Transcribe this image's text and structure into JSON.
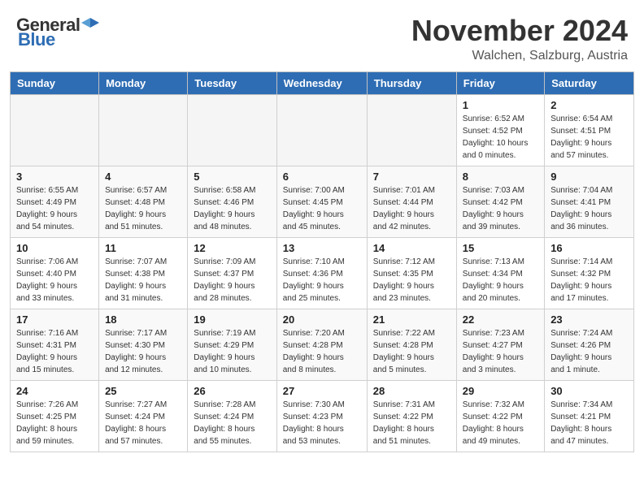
{
  "header": {
    "logo_general": "General",
    "logo_blue": "Blue",
    "month": "November 2024",
    "location": "Walchen, Salzburg, Austria"
  },
  "weekdays": [
    "Sunday",
    "Monday",
    "Tuesday",
    "Wednesday",
    "Thursday",
    "Friday",
    "Saturday"
  ],
  "weeks": [
    [
      {
        "day": "",
        "info": ""
      },
      {
        "day": "",
        "info": ""
      },
      {
        "day": "",
        "info": ""
      },
      {
        "day": "",
        "info": ""
      },
      {
        "day": "",
        "info": ""
      },
      {
        "day": "1",
        "info": "Sunrise: 6:52 AM\nSunset: 4:52 PM\nDaylight: 10 hours\nand 0 minutes."
      },
      {
        "day": "2",
        "info": "Sunrise: 6:54 AM\nSunset: 4:51 PM\nDaylight: 9 hours\nand 57 minutes."
      }
    ],
    [
      {
        "day": "3",
        "info": "Sunrise: 6:55 AM\nSunset: 4:49 PM\nDaylight: 9 hours\nand 54 minutes."
      },
      {
        "day": "4",
        "info": "Sunrise: 6:57 AM\nSunset: 4:48 PM\nDaylight: 9 hours\nand 51 minutes."
      },
      {
        "day": "5",
        "info": "Sunrise: 6:58 AM\nSunset: 4:46 PM\nDaylight: 9 hours\nand 48 minutes."
      },
      {
        "day": "6",
        "info": "Sunrise: 7:00 AM\nSunset: 4:45 PM\nDaylight: 9 hours\nand 45 minutes."
      },
      {
        "day": "7",
        "info": "Sunrise: 7:01 AM\nSunset: 4:44 PM\nDaylight: 9 hours\nand 42 minutes."
      },
      {
        "day": "8",
        "info": "Sunrise: 7:03 AM\nSunset: 4:42 PM\nDaylight: 9 hours\nand 39 minutes."
      },
      {
        "day": "9",
        "info": "Sunrise: 7:04 AM\nSunset: 4:41 PM\nDaylight: 9 hours\nand 36 minutes."
      }
    ],
    [
      {
        "day": "10",
        "info": "Sunrise: 7:06 AM\nSunset: 4:40 PM\nDaylight: 9 hours\nand 33 minutes."
      },
      {
        "day": "11",
        "info": "Sunrise: 7:07 AM\nSunset: 4:38 PM\nDaylight: 9 hours\nand 31 minutes."
      },
      {
        "day": "12",
        "info": "Sunrise: 7:09 AM\nSunset: 4:37 PM\nDaylight: 9 hours\nand 28 minutes."
      },
      {
        "day": "13",
        "info": "Sunrise: 7:10 AM\nSunset: 4:36 PM\nDaylight: 9 hours\nand 25 minutes."
      },
      {
        "day": "14",
        "info": "Sunrise: 7:12 AM\nSunset: 4:35 PM\nDaylight: 9 hours\nand 23 minutes."
      },
      {
        "day": "15",
        "info": "Sunrise: 7:13 AM\nSunset: 4:34 PM\nDaylight: 9 hours\nand 20 minutes."
      },
      {
        "day": "16",
        "info": "Sunrise: 7:14 AM\nSunset: 4:32 PM\nDaylight: 9 hours\nand 17 minutes."
      }
    ],
    [
      {
        "day": "17",
        "info": "Sunrise: 7:16 AM\nSunset: 4:31 PM\nDaylight: 9 hours\nand 15 minutes."
      },
      {
        "day": "18",
        "info": "Sunrise: 7:17 AM\nSunset: 4:30 PM\nDaylight: 9 hours\nand 12 minutes."
      },
      {
        "day": "19",
        "info": "Sunrise: 7:19 AM\nSunset: 4:29 PM\nDaylight: 9 hours\nand 10 minutes."
      },
      {
        "day": "20",
        "info": "Sunrise: 7:20 AM\nSunset: 4:28 PM\nDaylight: 9 hours\nand 8 minutes."
      },
      {
        "day": "21",
        "info": "Sunrise: 7:22 AM\nSunset: 4:28 PM\nDaylight: 9 hours\nand 5 minutes."
      },
      {
        "day": "22",
        "info": "Sunrise: 7:23 AM\nSunset: 4:27 PM\nDaylight: 9 hours\nand 3 minutes."
      },
      {
        "day": "23",
        "info": "Sunrise: 7:24 AM\nSunset: 4:26 PM\nDaylight: 9 hours\nand 1 minute."
      }
    ],
    [
      {
        "day": "24",
        "info": "Sunrise: 7:26 AM\nSunset: 4:25 PM\nDaylight: 8 hours\nand 59 minutes."
      },
      {
        "day": "25",
        "info": "Sunrise: 7:27 AM\nSunset: 4:24 PM\nDaylight: 8 hours\nand 57 minutes."
      },
      {
        "day": "26",
        "info": "Sunrise: 7:28 AM\nSunset: 4:24 PM\nDaylight: 8 hours\nand 55 minutes."
      },
      {
        "day": "27",
        "info": "Sunrise: 7:30 AM\nSunset: 4:23 PM\nDaylight: 8 hours\nand 53 minutes."
      },
      {
        "day": "28",
        "info": "Sunrise: 7:31 AM\nSunset: 4:22 PM\nDaylight: 8 hours\nand 51 minutes."
      },
      {
        "day": "29",
        "info": "Sunrise: 7:32 AM\nSunset: 4:22 PM\nDaylight: 8 hours\nand 49 minutes."
      },
      {
        "day": "30",
        "info": "Sunrise: 7:34 AM\nSunset: 4:21 PM\nDaylight: 8 hours\nand 47 minutes."
      }
    ]
  ]
}
